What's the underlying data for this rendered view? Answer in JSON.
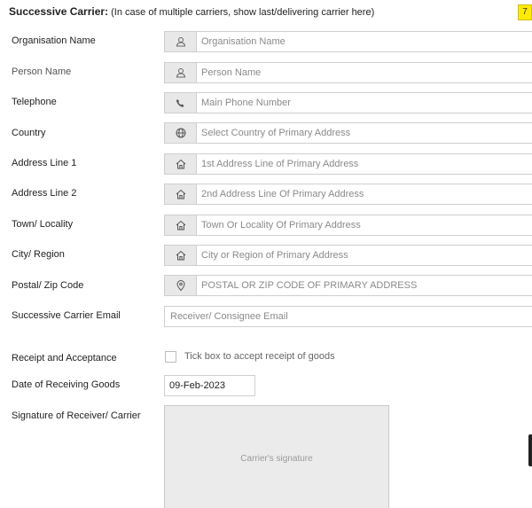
{
  "header": {
    "title": "Successive Carrier:",
    "note": "(In case of multiple carriers, show last/delivering carrier here)",
    "step_badge": "7"
  },
  "fields": {
    "organisation_name": {
      "label": "Organisation Name",
      "placeholder": "Organisation Name",
      "icon": "user-icon"
    },
    "person_name": {
      "label": "Person Name",
      "placeholder": "Person Name",
      "icon": "user-icon"
    },
    "telephone": {
      "label": "Telephone",
      "placeholder": "Main Phone Number",
      "icon": "phone-icon"
    },
    "country": {
      "label": "Country",
      "placeholder": "Select Country of Primary Address",
      "icon": "globe-icon"
    },
    "address_line_1": {
      "label": "Address Line 1",
      "placeholder": "1st Address Line of Primary Address",
      "icon": "home-icon"
    },
    "address_line_2": {
      "label": "Address Line 2",
      "placeholder": "2nd Address Line Of Primary Address",
      "icon": "home-icon"
    },
    "town_locality": {
      "label": "Town/ Locality",
      "placeholder": "Town Or Locality Of Primary Address",
      "icon": "home-icon"
    },
    "city_region": {
      "label": "City/ Region",
      "placeholder": "City or Region of Primary Address",
      "icon": "home-icon"
    },
    "postal_code": {
      "label": "Postal/ Zip Code",
      "placeholder": "POSTAL OR ZIP CODE OF PRIMARY ADDRESS",
      "icon": "map-pin-icon"
    },
    "carrier_email": {
      "label": "Successive Carrier Email",
      "placeholder": "Receiver/ Consignee Email"
    }
  },
  "receipt": {
    "label": "Receipt and Acceptance",
    "checkbox_label": "Tick box to accept receipt of goods",
    "checked": false
  },
  "date_receiving": {
    "label": "Date of Receiving Goods",
    "value": "09-Feb-2023"
  },
  "signature": {
    "label": "Signature of Receiver/ Carrier",
    "placeholder": "Carrier's signature"
  },
  "colors": {
    "badge": "#ffeb00",
    "addon_bg": "#e8e8e8",
    "border": "#cfcfcf",
    "signature_bg": "#ebebeb"
  }
}
